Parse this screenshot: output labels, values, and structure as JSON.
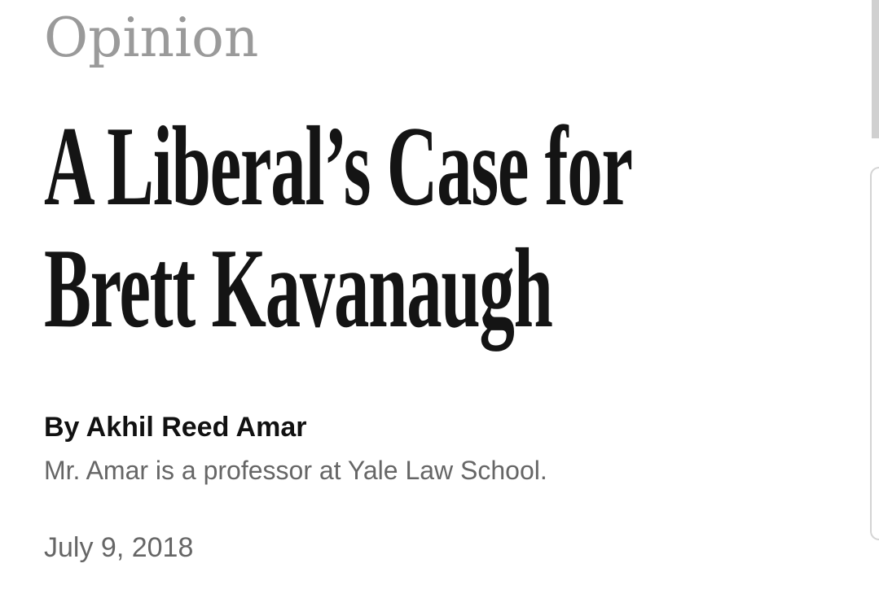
{
  "article": {
    "section": "Opinion",
    "headline_lines": [
      "A Liberal’s Case for",
      "Brett Kavanaugh"
    ],
    "byline": "By Akhil Reed Amar",
    "author_bio": "Mr. Amar is a professor at Yale Law School.",
    "date": "July 9, 2018"
  },
  "colors": {
    "section_gray": "#9a9a9a",
    "headline_black": "#141414",
    "meta_gray": "#666666"
  }
}
